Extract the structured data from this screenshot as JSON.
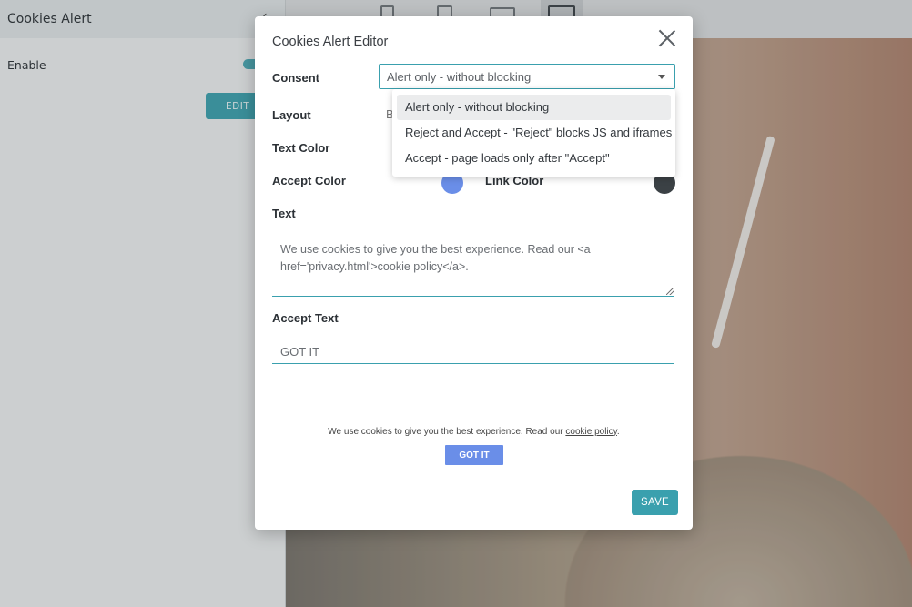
{
  "background_app": {
    "panel_title": "Cookies Alert",
    "enable_label": "Enable",
    "edit_label": "EDIT",
    "check_glyph": "✓",
    "enable_on": true
  },
  "modal": {
    "title": "Cookies Alert Editor",
    "consent": {
      "label": "Consent",
      "value": "Alert only - without blocking",
      "options": [
        "Alert only - without blocking",
        "Reject and Accept - \"Reject\" blocks JS and iframes",
        "Accept - page loads only after \"Accept\""
      ]
    },
    "layout": {
      "label": "Layout",
      "value_partial": "B"
    },
    "text_color": {
      "label": "Text Color"
    },
    "accept_color": {
      "label": "Accept Color",
      "color": "#6a8ee8"
    },
    "link_color": {
      "label": "Link Color",
      "color": "#3b4145"
    },
    "text": {
      "label": "Text",
      "value": "We use cookies to give you the best experience. Read our <a href='privacy.html'>cookie policy</a>."
    },
    "accept_text": {
      "label": "Accept Text",
      "value": "GOT IT"
    },
    "preview": {
      "message": "We use cookies to give you the best experience. Read our",
      "link": "cookie policy",
      "trailing": ".",
      "button": "GOT IT"
    },
    "save_label": "SAVE"
  },
  "colors": {
    "accent": "#3aa0ae",
    "accept_button": "#6a8ee8"
  }
}
